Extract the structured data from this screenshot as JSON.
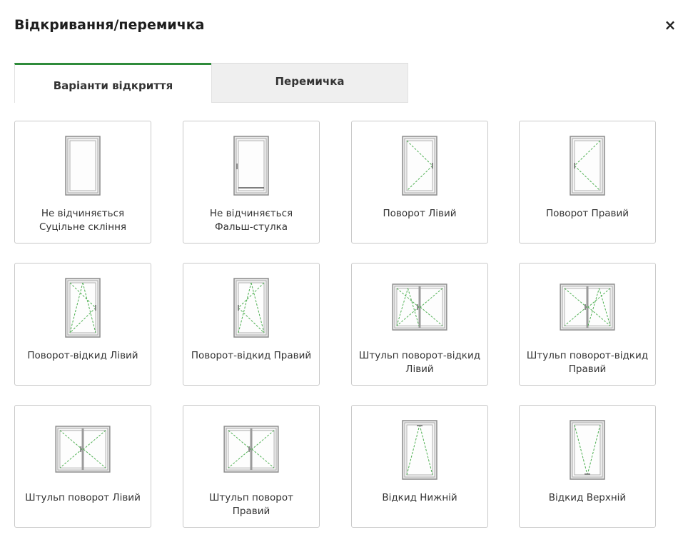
{
  "dialog": {
    "title": "Відкривання/перемичка",
    "close_label": "×"
  },
  "tabs": [
    {
      "label": "Варіанти відкриття",
      "active": true
    },
    {
      "label": "Перемичка",
      "active": false
    }
  ],
  "colors": {
    "accent": "#2e8b3a",
    "hinge_line": "#4caf50"
  },
  "options": [
    {
      "line1": "Не відчиняється",
      "line2": "Суцільне скління",
      "icon": "fixed-window-icon"
    },
    {
      "line1": "Не відчиняється",
      "line2": "Фальш-стулка",
      "icon": "fake-sash-window-icon"
    },
    {
      "line1": "Поворот Лівий",
      "line2": "",
      "icon": "turn-left-window-icon"
    },
    {
      "line1": "Поворот Правий",
      "line2": "",
      "icon": "turn-right-window-icon"
    },
    {
      "line1": "Поворот-відкид Лівий",
      "line2": "",
      "icon": "tilt-turn-left-window-icon"
    },
    {
      "line1": "Поворот-відкид Правий",
      "line2": "",
      "icon": "tilt-turn-right-window-icon"
    },
    {
      "line1": "Штульп поворот-відкид",
      "line2": "Лівий",
      "icon": "double-tilt-turn-left-window-icon"
    },
    {
      "line1": "Штульп поворот-відкид",
      "line2": "Правий",
      "icon": "double-tilt-turn-right-window-icon"
    },
    {
      "line1": "Штульп поворот Лівий",
      "line2": "",
      "icon": "double-turn-left-window-icon"
    },
    {
      "line1": "Штульп поворот",
      "line2": "Правий",
      "icon": "double-turn-right-window-icon"
    },
    {
      "line1": "Відкид Нижній",
      "line2": "",
      "icon": "tilt-bottom-window-icon"
    },
    {
      "line1": "Відкид Верхній",
      "line2": "",
      "icon": "tilt-top-window-icon"
    }
  ]
}
